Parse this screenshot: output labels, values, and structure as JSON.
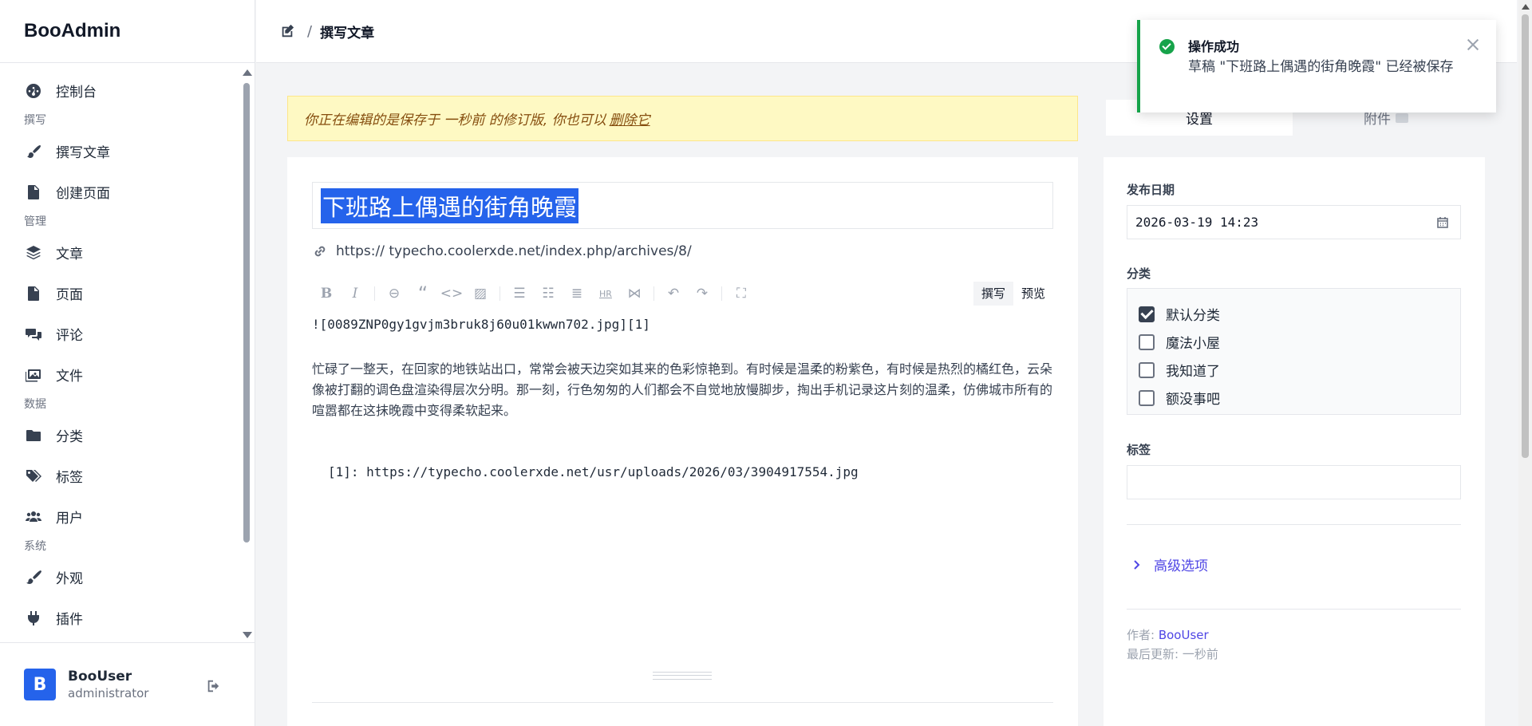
{
  "brand": "BooAdmin",
  "nav": {
    "dashboard": "控制台",
    "group_write": "撰写",
    "write_post": "撰写文章",
    "create_page": "创建页面",
    "group_manage": "管理",
    "posts": "文章",
    "pages": "页面",
    "comments": "评论",
    "files": "文件",
    "group_data": "数据",
    "categories": "分类",
    "tags": "标签",
    "users": "用户",
    "group_system": "系统",
    "appearance": "外观",
    "plugins": "插件"
  },
  "user": {
    "initial": "B",
    "name": "BooUser",
    "role": "administrator"
  },
  "breadcrumb": {
    "separator": "/",
    "title": "撰写文章"
  },
  "notice": {
    "text": "你正在编辑的是保存于 一秒前 的修订版, 你也可以",
    "link": "删除它"
  },
  "editor": {
    "title": "下班路上偶遇的街角晚霞",
    "permalink": "https:// typecho.coolerxde.net/index.php/archives/8/",
    "mode_write": "撰写",
    "mode_preview": "预览",
    "line1": "![0089ZNP0gy1gvjm3bruk8j60u01kwwn702.jpg][1]",
    "paragraph": "忙碌了一整天，在回家的地铁站出口，常常会被天边突如其来的色彩惊艳到。有时候是温柔的粉紫色，有时候是热烈的橘红色，云朵像被打翻的调色盘渲染得层次分明。那一刻，行色匆匆的人们都会不自觉地放慢脚步，掏出手机记录这片刻的温柔，仿佛城市所有的喧嚣都在这抹晚霞中变得柔软起来。",
    "reference": "[1]: https://typecho.coolerxde.net/usr/uploads/2026/03/3904917554.jpg"
  },
  "tabs": {
    "settings": "设置",
    "attachments": "附件"
  },
  "settings": {
    "date_label": "发布日期",
    "date_value": "2026-03-19 14:23",
    "category_label": "分类",
    "categories": [
      {
        "name": "默认分类",
        "checked": true
      },
      {
        "name": "魔法小屋",
        "checked": false
      },
      {
        "name": "我知道了",
        "checked": false
      },
      {
        "name": "额没事吧",
        "checked": false
      }
    ],
    "tags_label": "标签",
    "advanced": "高级选项",
    "author_label": "作者:",
    "author": "BooUser",
    "updated_label": "最后更新:",
    "updated": "一秒前"
  },
  "toast": {
    "title": "操作成功",
    "body": "草稿 \"下班路上偶遇的街角晚霞\" 已经被保存"
  },
  "colors": {
    "accent": "#2563eb",
    "success": "#16a34a",
    "link": "#4f46e5",
    "notice_bg": "#fef9c3"
  }
}
